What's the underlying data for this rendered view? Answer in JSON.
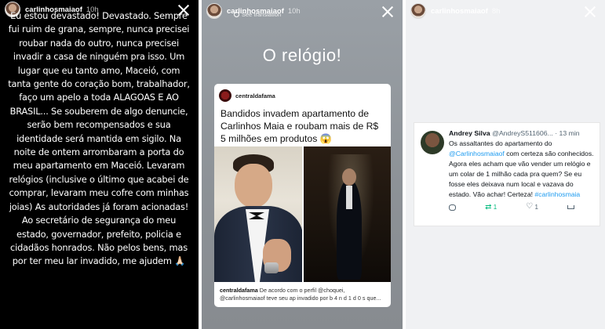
{
  "panel1": {
    "username": "carlinhosmaiaof",
    "time": "10h",
    "text": "Eu estou devastado! Devastado. Sempre fui ruim de grana, sempre, nunca precisei roubar nada do outro, nunca precisei invadir a casa de ninguém pra isso. Um lugar que eu tanto amo, Maceió, com tanta gente do coração bom, trabalhador, faço um apelo a toda ALAGOAS E AO BRASIL... Se souberem de algo denuncie, serão bem recompensados e sua identidade será mantida em sigilo. Na noite de ontem arrombaram a porta do meu apartamento em Maceió. Levaram relógios (inclusive o último que acabei de comprar, levaram meu cofre com minhas joias) As autoridades já foram acionadas! Ao secretário de segurança do meu estado, governador, prefeito, policia e cidadãos honrados. Não pelos bens, mas por ter meu lar invadido, me ajudem 🙏🏻"
  },
  "panel2": {
    "username": "carlinhosmaiaof",
    "time": "10h",
    "see_translation": "See translation",
    "headline": "O relógio!",
    "card": {
      "account": "centraldafama",
      "title": "Bandidos invadem apartamento de Carlinhos Maia e roubam mais de R$ 5 milhões em produtos 😱",
      "caption_account": "centraldafama",
      "caption_line1": " De acordo com o perfil @choquei,",
      "caption_line2": "@carlinhosmaiaof teve seu ap invadido por b 4 n d 1 d 0 s que..."
    }
  },
  "panel3": {
    "username": "carlinhosmaiaof",
    "time": "8h",
    "tweet": {
      "name": "Andrey Silva",
      "handle": "@AndreyS511606...",
      "time": "· 13 min",
      "text_part1": "Os assaltantes do apartamento do",
      "mention": "@Carlinhosmaiaof",
      "text_part2": " com certeza são conhecidos. Agora eles acham que vão vender um relógio e um colar de 1 milhão cada pra quem? Se eu fosse eles deixava num local e vazava do estado. Vão achar! Certeza!",
      "hashtag": "#carlinhosmaia",
      "retweets": "1",
      "likes": "1"
    }
  }
}
